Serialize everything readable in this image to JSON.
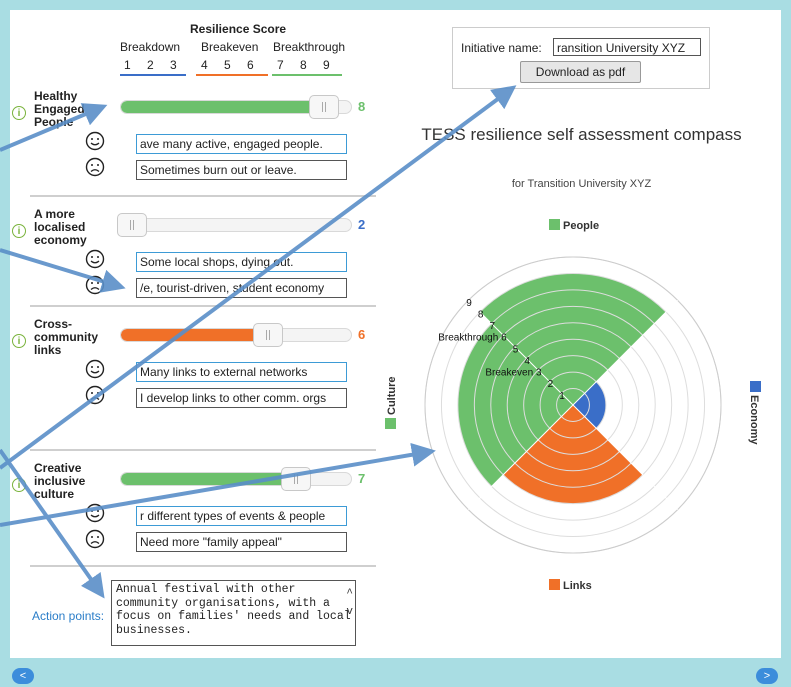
{
  "scale": {
    "title": "Resilience Score",
    "categories": [
      "Breakdown",
      "Breakeven",
      "Breakthrough"
    ],
    "numbers": [
      "1",
      "2",
      "3",
      "4",
      "5",
      "6",
      "7",
      "8",
      "9"
    ],
    "colors": [
      "#3a6ec8",
      "#f07028",
      "#6cc06c"
    ]
  },
  "sections": [
    {
      "title": "Healthy Engaged People",
      "score": 8,
      "fill_fraction": 0.88,
      "color": "#6cc06c",
      "positive": "ave many active, engaged people.",
      "negative": "Sometimes burn out or leave."
    },
    {
      "title": "A more localised economy",
      "score": 2,
      "fill_fraction": 0.05,
      "color": "#3a6ec8",
      "positive": "Some local shops, dying out.",
      "negative": "/e, tourist-driven, student economy"
    },
    {
      "title": "Cross-community links",
      "score": 6,
      "fill_fraction": 0.64,
      "color": "#f07028",
      "positive": "Many links to external networks",
      "negative": "I develop links to other comm. orgs"
    },
    {
      "title": "Creative inclusive culture",
      "score": 7,
      "fill_fraction": 0.76,
      "color": "#6cc06c",
      "positive": "r different types of events & people",
      "negative": "Need more \"family appeal\""
    }
  ],
  "action_points": {
    "label": "Action points:",
    "text": "Annual festival with other community organisations, with a focus on families' needs and local businesses."
  },
  "initiative": {
    "label": "Initiative name:",
    "value": "ransition University XYZ"
  },
  "download_label": "Download as pdf",
  "nav": {
    "prev": "<",
    "next": ">"
  },
  "chart_data": {
    "type": "polar-area",
    "title": "TESS resilience self assessment compass",
    "subtitle": "for Transition University XYZ",
    "categories": [
      "People",
      "Economy",
      "Links",
      "Culture"
    ],
    "values": [
      8,
      2,
      6,
      7
    ],
    "colors": [
      "#6cc06c",
      "#3a6ec8",
      "#f07028",
      "#6cc06c"
    ],
    "rmax": 9,
    "ring_labels": [
      "1",
      "2",
      "Breakeven 3",
      "4",
      "5",
      "Breakthrough 6",
      "7",
      "8",
      "9"
    ],
    "legend_placement": "around"
  }
}
